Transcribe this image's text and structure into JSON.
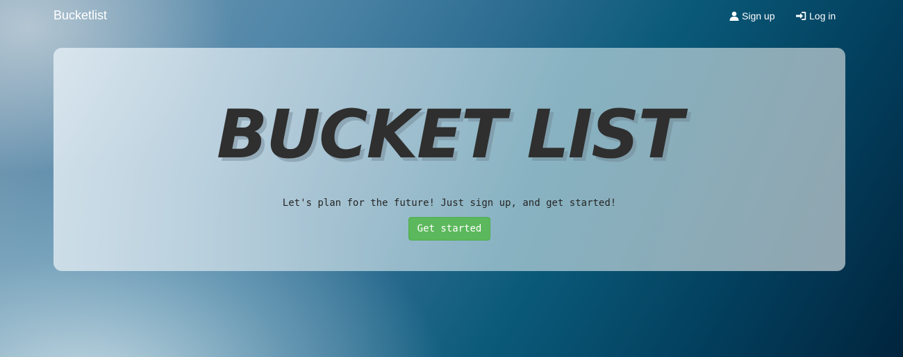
{
  "navbar": {
    "brand": "Bucketlist",
    "links": [
      {
        "label": "Sign up",
        "icon": "user-icon"
      },
      {
        "label": "Log in",
        "icon": "log-in-icon"
      }
    ]
  },
  "hero": {
    "title": "BUCKET LIST",
    "tagline": "Let's plan for the future! Just sign up, and get started!",
    "cta_label": "Get started"
  },
  "colors": {
    "cta": "#5cb85c",
    "title": "#2f2f2f",
    "nav_text": "#ffffff"
  }
}
